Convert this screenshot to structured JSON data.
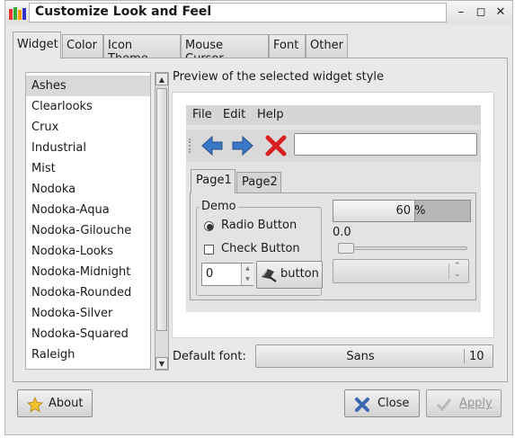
{
  "window": {
    "title": "Customize Look and Feel"
  },
  "tabs": [
    "Widget",
    "Color",
    "Icon Theme",
    "Mouse Cursor",
    "Font",
    "Other"
  ],
  "themes": [
    "Ashes",
    "Clearlooks",
    "Crux",
    "Industrial",
    "Mist",
    "Nodoka",
    "Nodoka-Aqua",
    "Nodoka-Gilouche",
    "Nodoka-Looks",
    "Nodoka-Midnight",
    "Nodoka-Rounded",
    "Nodoka-Silver",
    "Nodoka-Squared",
    "Raleigh"
  ],
  "selected_theme": "Ashes",
  "preview": {
    "label": "Preview of the selected widget style",
    "menus": [
      "File",
      "Edit",
      "Help"
    ],
    "entry_value": "",
    "tabs": [
      "Page1",
      "Page2"
    ],
    "frame_label": "Demo",
    "radio_label": "Radio Button",
    "check_label": "Check Button",
    "spin_value": "0",
    "button_label": "button",
    "progress_text": "60 %",
    "progress_value": 0.6,
    "scale_value": "0.0",
    "icons": [
      "back-arrow-icon",
      "forward-arrow-icon",
      "stop-icon",
      "screwdriver-icon"
    ]
  },
  "font": {
    "label": "Default font:",
    "name": "Sans",
    "size": "10"
  },
  "buttons": {
    "about": "About",
    "close": "Close",
    "apply": "Apply"
  },
  "colors": {
    "accent_blue": "#3a78c8",
    "stop_red": "#d82020",
    "selection": "#d9d9d9"
  }
}
